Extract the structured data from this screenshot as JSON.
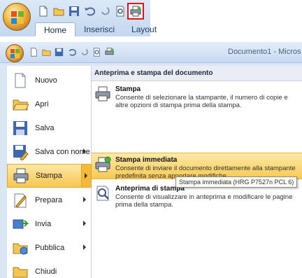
{
  "top_snippet": {
    "tabs": [
      {
        "label": "Home",
        "active": true
      },
      {
        "label": "Inserisci",
        "active": false
      },
      {
        "label": "Layout",
        "active": false
      }
    ],
    "highlighted_button": "quick-print-icon",
    "highlight_color": "#e0141e"
  },
  "window": {
    "title": "Documento1 - Micros"
  },
  "menu": {
    "items": [
      {
        "label": "Nuovo",
        "icon": "new-document-icon",
        "has_submenu": false
      },
      {
        "label": "Apri",
        "icon": "open-folder-icon",
        "has_submenu": false
      },
      {
        "label": "Salva",
        "icon": "save-icon",
        "has_submenu": false
      },
      {
        "label": "Salva con nome",
        "icon": "save-as-icon",
        "has_submenu": true
      },
      {
        "label": "Stampa",
        "icon": "printer-icon",
        "has_submenu": true,
        "selected": true
      },
      {
        "label": "Prepara",
        "icon": "prepare-icon",
        "has_submenu": true
      },
      {
        "label": "Invia",
        "icon": "send-icon",
        "has_submenu": true
      },
      {
        "label": "Pubblica",
        "icon": "publish-icon",
        "has_submenu": true
      },
      {
        "label": "Chiudi",
        "icon": "close-folder-icon",
        "has_submenu": false
      }
    ]
  },
  "panel": {
    "header": "Anteprima e stampa del documento",
    "options": [
      {
        "title": "Stampa",
        "description": "Consente di selezionare la stampante, il numero di copie e altre opzioni di stampa prima della stampa.",
        "icon": "printer-icon",
        "highlighted": false
      },
      {
        "title": "Stampa immediata",
        "description": "Consente di inviare il documento direttamente alla stampante predefinita senza apportare modifiche.",
        "icon": "quick-print-icon",
        "highlighted": true
      },
      {
        "title": "Anteprima di stampa",
        "description": "Consente di visualizzare in anteprima e modificare le pagine prima della stampa.",
        "icon": "print-preview-icon",
        "highlighted": false
      }
    ],
    "tooltip": "Stampa immediata (HRG P7527n PCL 6)"
  },
  "colors": {
    "selection_fill": "#f7c650",
    "selection_border": "#e1a82a",
    "ribbon_blue": "#c8daf1"
  }
}
